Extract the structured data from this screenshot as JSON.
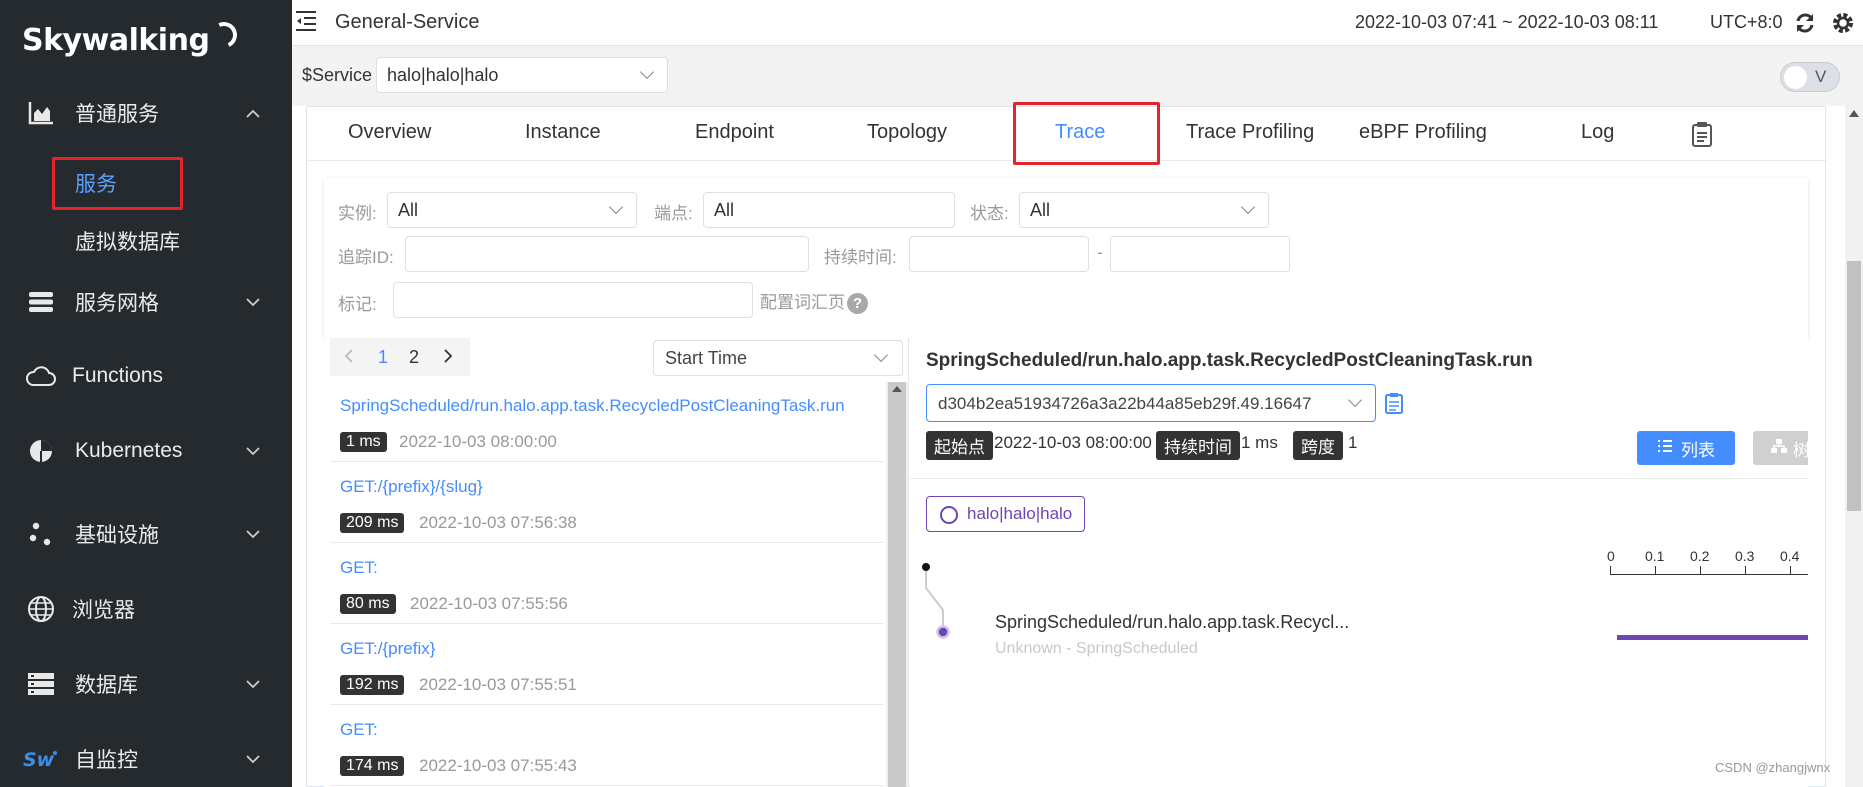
{
  "sidebar": {
    "logo": "Skywalking",
    "items": [
      {
        "label": "普通服务",
        "icon": "area-chart-icon"
      },
      {
        "label": "服务网格",
        "icon": "server-stack-icon"
      },
      {
        "label": "Functions",
        "icon": "cloud-icon"
      },
      {
        "label": "Kubernetes",
        "icon": "pie-chart-icon"
      },
      {
        "label": "基础设施",
        "icon": "nodes-icon"
      },
      {
        "label": "浏览器",
        "icon": "globe-icon"
      },
      {
        "label": "数据库",
        "icon": "database-icon"
      },
      {
        "label": "自监控",
        "icon": "sw-logo-icon"
      }
    ],
    "sub_items": [
      {
        "label": "服务",
        "active": true
      },
      {
        "label": "虚拟数据库",
        "active": false
      }
    ]
  },
  "header": {
    "title": "General-Service",
    "time_range": "2022-10-03 07:41 ~ 2022-10-03 08:11",
    "timezone": "UTC+8:0"
  },
  "service_bar": {
    "label": "$Service",
    "selected": "halo|halo|halo",
    "toggle_label": "V"
  },
  "tabs": [
    "Overview",
    "Instance",
    "Endpoint",
    "Topology",
    "Trace",
    "Trace Profiling",
    "eBPF Profiling",
    "Log"
  ],
  "active_tab": "Trace",
  "filters": {
    "instance_label": "实例:",
    "instance_value": "All",
    "endpoint_label": "端点:",
    "endpoint_value": "All",
    "status_label": "状态:",
    "status_value": "All",
    "trace_id_label": "追踪ID:",
    "duration_label": "持续时间:",
    "duration_sep": "-",
    "tags_label": "标记:",
    "vocab_link": "配置词汇页",
    "help_glyph": "?"
  },
  "trace_list": {
    "pages": [
      "1",
      "2"
    ],
    "current_page": "1",
    "sort": "Start Time",
    "items": [
      {
        "name": "SpringScheduled/run.halo.app.task.RecycledPostCleaningTask.run",
        "duration": "1 ms",
        "time": "2022-10-03 08:00:00"
      },
      {
        "name": "GET:/{prefix}/{slug}",
        "duration": "209 ms",
        "time": "2022-10-03 07:56:38"
      },
      {
        "name": "GET:",
        "duration": "80 ms",
        "time": "2022-10-03 07:55:56"
      },
      {
        "name": "GET:/{prefix}",
        "duration": "192 ms",
        "time": "2022-10-03 07:55:51"
      },
      {
        "name": "GET:",
        "duration": "174 ms",
        "time": "2022-10-03 07:55:43"
      }
    ]
  },
  "detail": {
    "title": "SpringScheduled/run.halo.app.task.RecycledPostCleaningTask.run",
    "trace_id": "d304b2ea51934726a3a22b44a85eb29f.49.16647",
    "start_label": "起始点",
    "start_value": "2022-10-03 08:00:00",
    "duration_label": "持续时间",
    "duration_value": "1 ms",
    "span_label": "跨度",
    "span_value": "1",
    "list_button": "列表",
    "tree_button": "树",
    "service_chip": "halo|halo|halo",
    "axis_ticks": [
      "0",
      "0.1",
      "0.2",
      "0.3",
      "0.4"
    ],
    "span": {
      "name": "SpringScheduled/run.halo.app.task.Recycl...",
      "sub": "Unknown - SpringScheduled"
    }
  },
  "watermark": "CSDN @zhangjwnx",
  "colors": {
    "accent": "#448dfe",
    "sidebar_bg": "#252a2f",
    "highlight_red": "#e0262c",
    "span_purple": "#6c47b4"
  }
}
